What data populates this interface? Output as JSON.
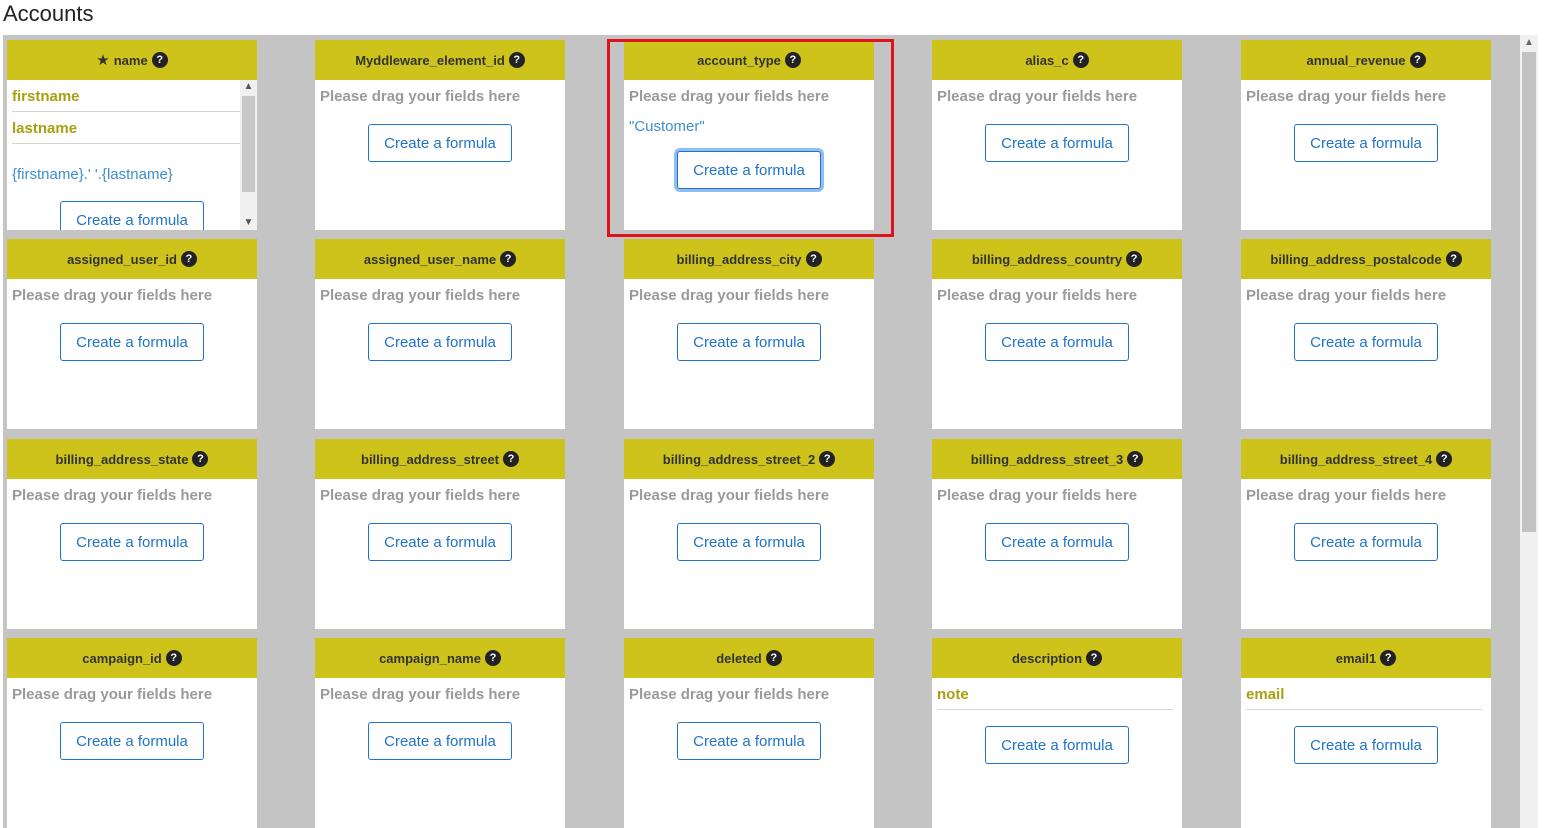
{
  "page": {
    "title": "Accounts"
  },
  "drag_hint": "Please drag your fields here",
  "formula_label": "Create a formula",
  "help_glyph": "?",
  "icons": {
    "required": "star-icon",
    "help": "help-icon"
  },
  "colors": {
    "card_header": "#cdc31b",
    "field_item": "#a8a010",
    "formula_text": "#3a8fd0",
    "button": "#1f73c9",
    "highlight": "#e0131c",
    "board": "#c4c4c4"
  },
  "cards": [
    {
      "name": "name",
      "required": true,
      "fields": [
        "firstname",
        "lastname"
      ],
      "formula": "{firstname}.' '.{lastname}"
    },
    {
      "name": "Myddleware_element_id",
      "fields": []
    },
    {
      "name": "account_type",
      "fields": [],
      "formula": "\"Customer\"",
      "highlighted": true
    },
    {
      "name": "alias_c",
      "fields": []
    },
    {
      "name": "annual_revenue",
      "fields": []
    },
    {
      "name": "assigned_user_id",
      "fields": []
    },
    {
      "name": "assigned_user_name",
      "fields": []
    },
    {
      "name": "billing_address_city",
      "fields": []
    },
    {
      "name": "billing_address_country",
      "fields": []
    },
    {
      "name": "billing_address_postalcode",
      "fields": []
    },
    {
      "name": "billing_address_state",
      "fields": []
    },
    {
      "name": "billing_address_street",
      "fields": []
    },
    {
      "name": "billing_address_street_2",
      "fields": []
    },
    {
      "name": "billing_address_street_3",
      "fields": []
    },
    {
      "name": "billing_address_street_4",
      "fields": []
    },
    {
      "name": "campaign_id",
      "fields": []
    },
    {
      "name": "campaign_name",
      "fields": []
    },
    {
      "name": "deleted",
      "fields": []
    },
    {
      "name": "description",
      "fields": [
        "note"
      ]
    },
    {
      "name": "email1",
      "fields": [
        "email"
      ]
    }
  ]
}
